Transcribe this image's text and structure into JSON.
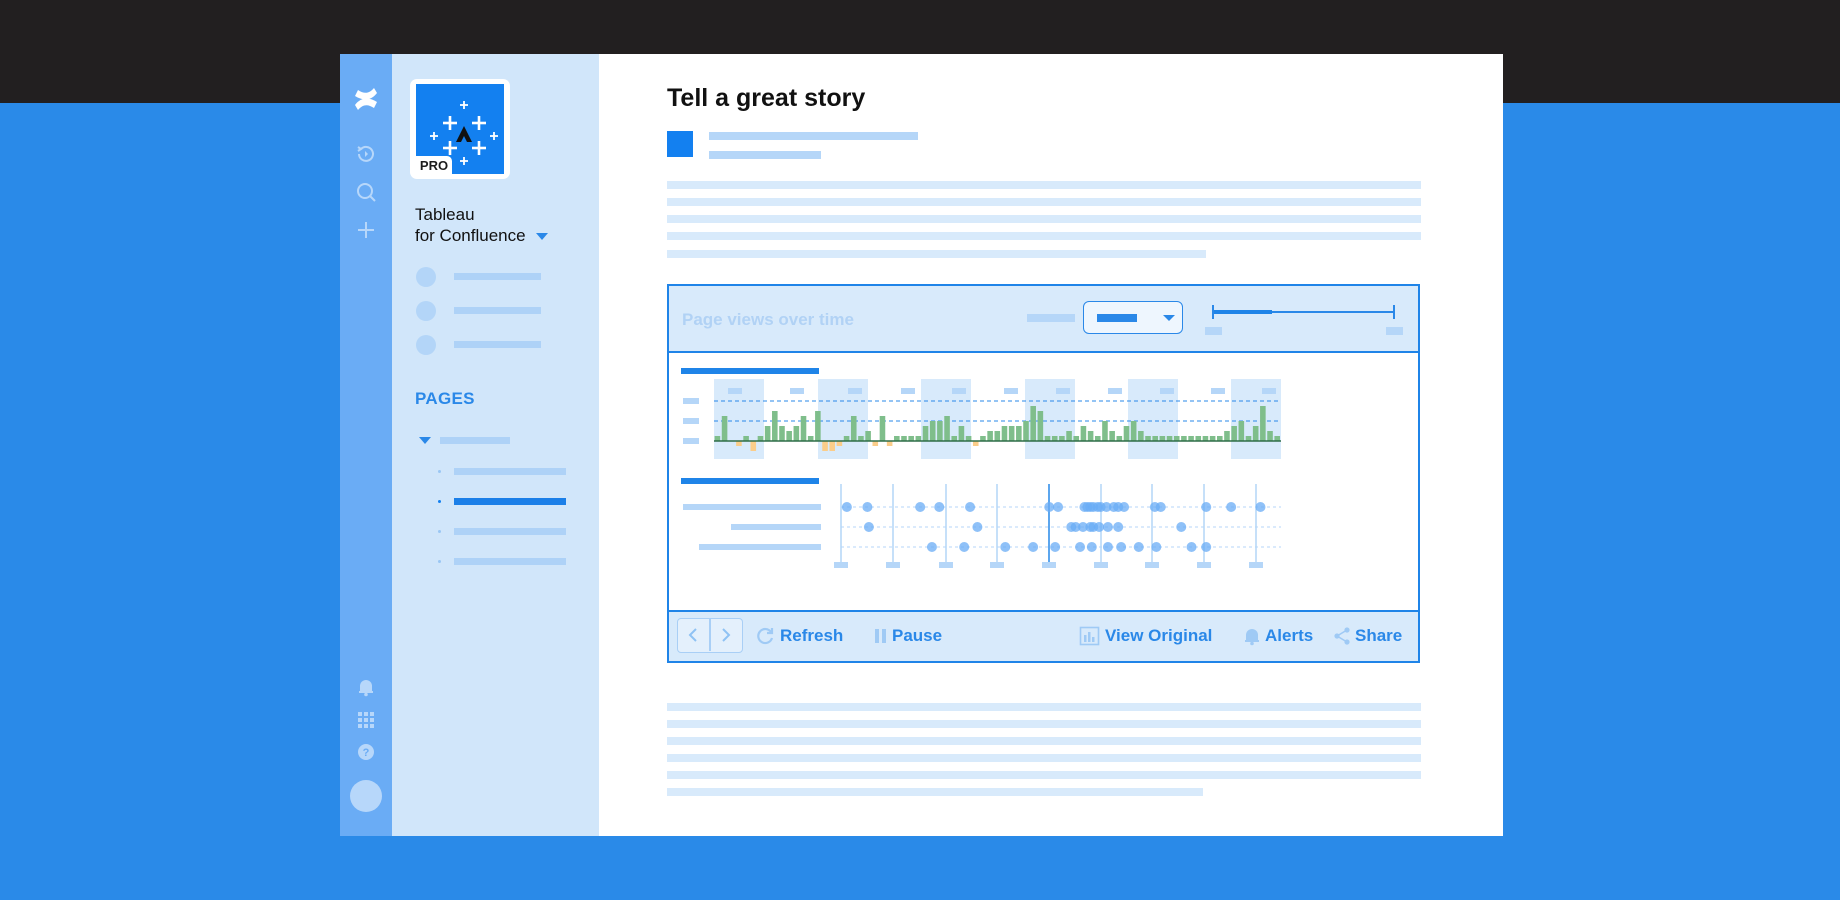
{
  "page": {
    "title": "Tell a great story"
  },
  "sidebar": {
    "app_name_line1": "Tableau",
    "app_name_line2": "for Confluence",
    "logo_badge": "PRO",
    "pages_heading": "PAGES"
  },
  "rail_icons": [
    "confluence-logo-icon",
    "recent-icon",
    "search-icon",
    "create-icon",
    "notifications-icon",
    "app-switcher-icon",
    "help-icon",
    "avatar"
  ],
  "viz": {
    "title": "Page views over time",
    "toolbar": {
      "refresh": "Refresh",
      "pause": "Pause",
      "view_original": "View Original",
      "alerts": "Alerts",
      "share": "Share"
    }
  },
  "colors": {
    "brand_blue": "#1380f0",
    "positive_bar": "#7fbe8b",
    "negative_bar": "#fbcd8a",
    "dot": "#6aacf5"
  },
  "chart_data": [
    {
      "type": "bar",
      "values": [
        1,
        5,
        0,
        -1,
        1,
        -2,
        1,
        3,
        6,
        3,
        2,
        3,
        5,
        1,
        6,
        -2,
        -2,
        -1,
        1,
        5,
        1,
        2,
        -1,
        5,
        -1,
        1,
        1,
        1,
        1,
        3,
        4,
        4,
        5,
        1,
        3,
        1,
        -1,
        1,
        2,
        2,
        3,
        3,
        3,
        4,
        7,
        6,
        1,
        1,
        1,
        2,
        1,
        3,
        2,
        1,
        4,
        2,
        1,
        3,
        4,
        2,
        1,
        1,
        1,
        1,
        1,
        1,
        1,
        1,
        1,
        1,
        1,
        2,
        3,
        4,
        1,
        3,
        7,
        2,
        1
      ]
    },
    {
      "type": "scatter",
      "rows": [
        [
          4,
          18,
          54,
          67,
          88,
          142,
          148,
          166,
          168,
          170,
          172,
          175,
          177,
          181,
          186,
          189,
          193,
          214,
          218,
          249,
          266,
          286
        ],
        [
          19,
          93,
          157,
          160,
          165,
          170,
          172,
          176,
          182,
          189,
          232
        ],
        [
          62,
          84,
          112,
          131,
          146,
          163,
          171,
          182,
          191,
          203,
          215,
          239,
          249
        ]
      ]
    }
  ]
}
